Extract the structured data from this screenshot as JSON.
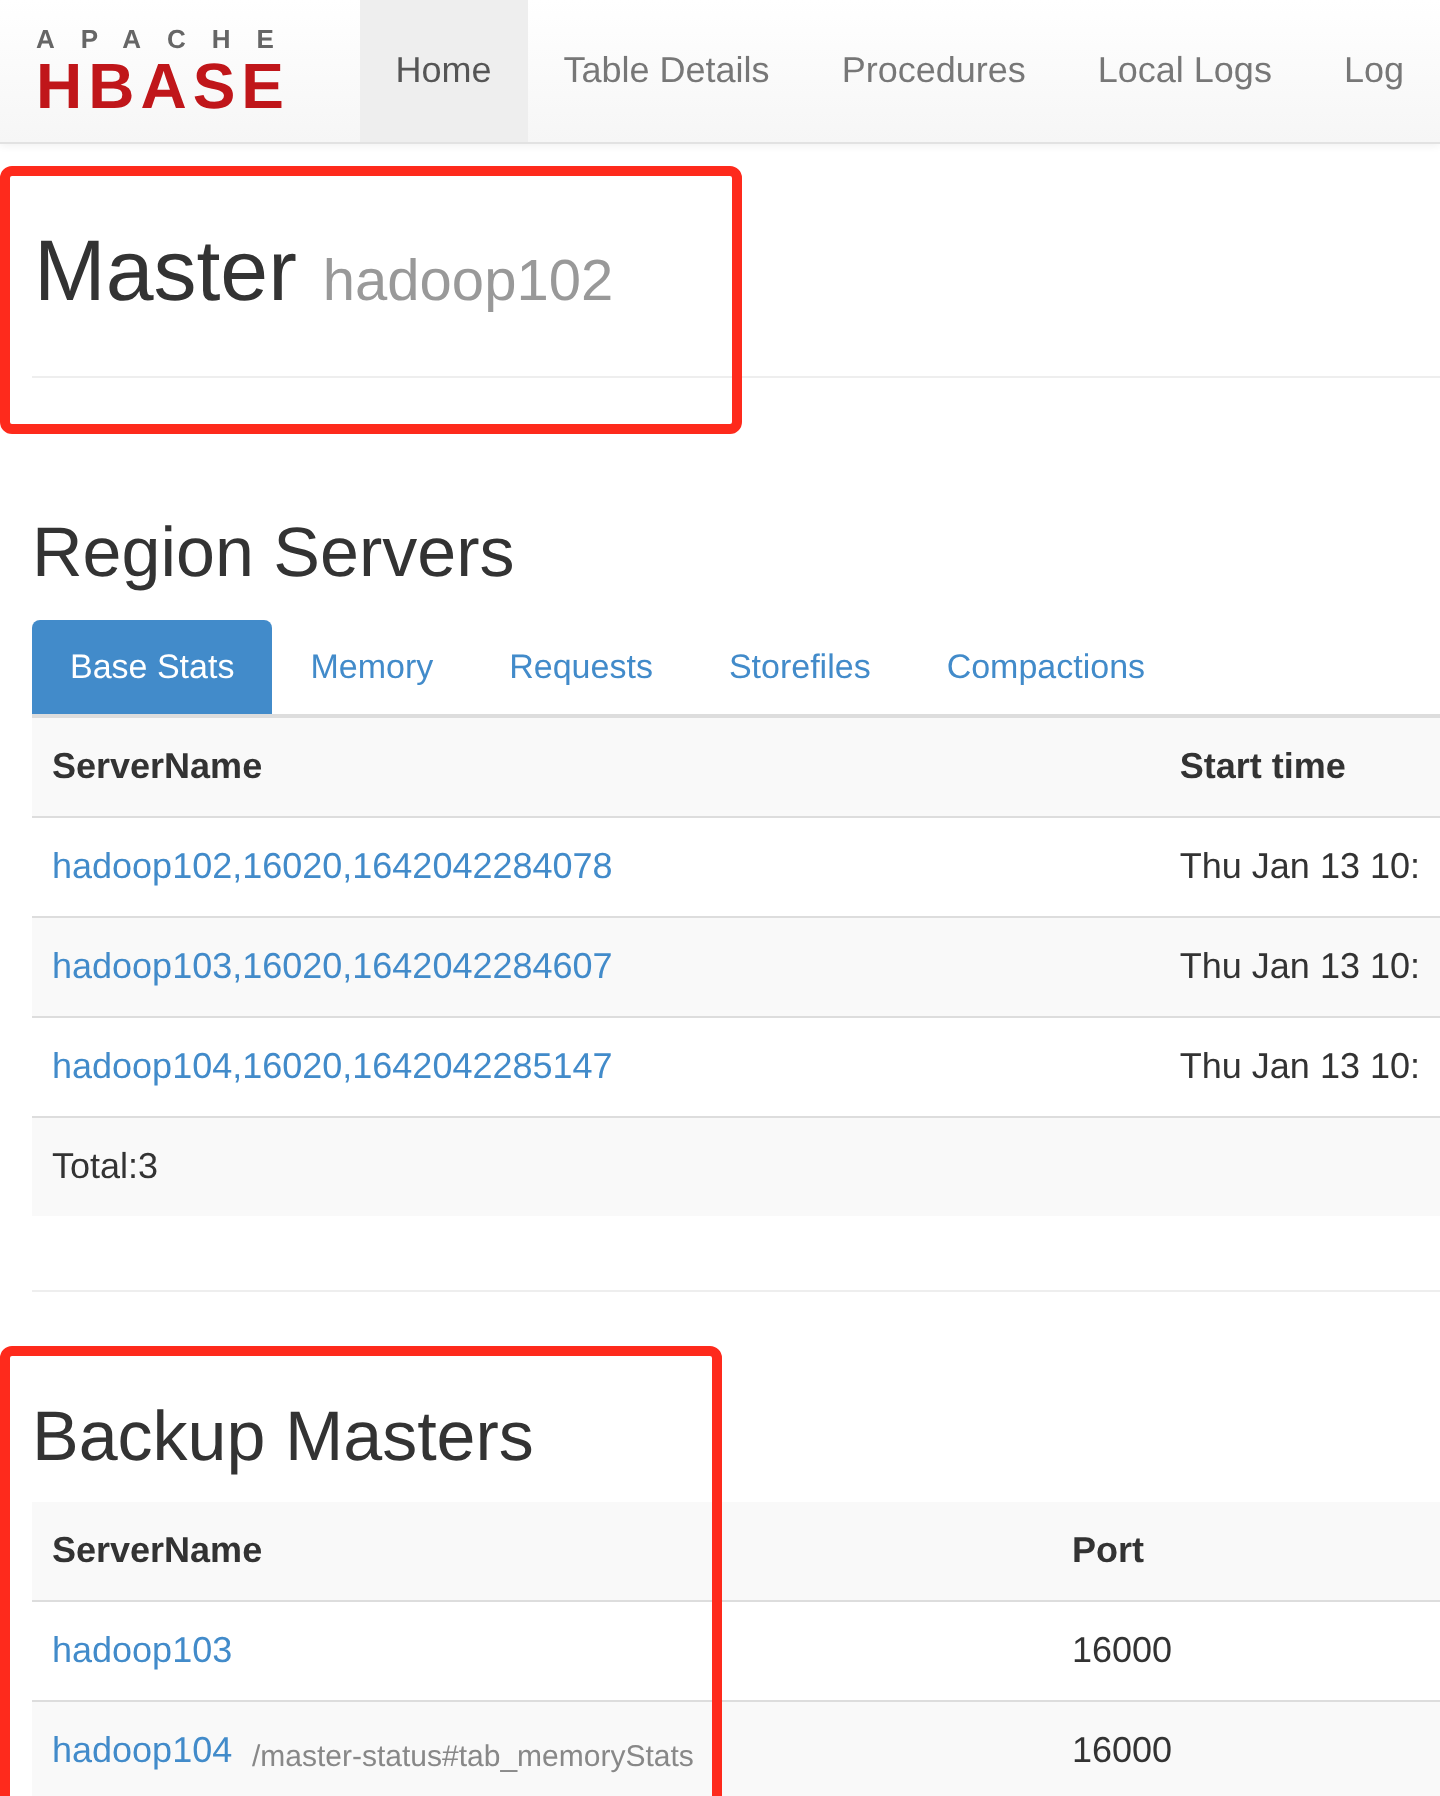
{
  "navbar": {
    "logo": {
      "top": "APACHE",
      "main": "HBASE"
    },
    "items": [
      {
        "label": "Home",
        "selected": true
      },
      {
        "label": "Table Details",
        "selected": false
      },
      {
        "label": "Procedures",
        "selected": false
      },
      {
        "label": "Local Logs",
        "selected": false
      },
      {
        "label": "Log",
        "selected": false
      }
    ]
  },
  "master_header": {
    "title": "Master",
    "host": "hadoop102",
    "highlighted": true
  },
  "region_servers": {
    "title": "Region Servers",
    "tabs": [
      {
        "label": "Base Stats",
        "selected": true
      },
      {
        "label": "Memory",
        "selected": false
      },
      {
        "label": "Requests",
        "selected": false
      },
      {
        "label": "Storefiles",
        "selected": false
      },
      {
        "label": "Compactions",
        "selected": false
      }
    ],
    "columns": [
      "ServerName",
      "Start time"
    ],
    "rows": [
      {
        "server": "hadoop102,16020,1642042284078",
        "start": "Thu Jan 13 10:"
      },
      {
        "server": "hadoop103,16020,1642042284607",
        "start": "Thu Jan 13 10:"
      },
      {
        "server": "hadoop104,16020,1642042285147",
        "start": "Thu Jan 13 10:"
      }
    ],
    "total": "Total:3"
  },
  "backup_masters": {
    "title": "Backup Masters",
    "highlighted": true,
    "columns": [
      "ServerName",
      "Port"
    ],
    "rows": [
      {
        "server": "hadoop103",
        "port": "16000"
      },
      {
        "server": "hadoop104",
        "port": "16000"
      }
    ]
  },
  "status_url": "/master-status#tab_memoryStats"
}
